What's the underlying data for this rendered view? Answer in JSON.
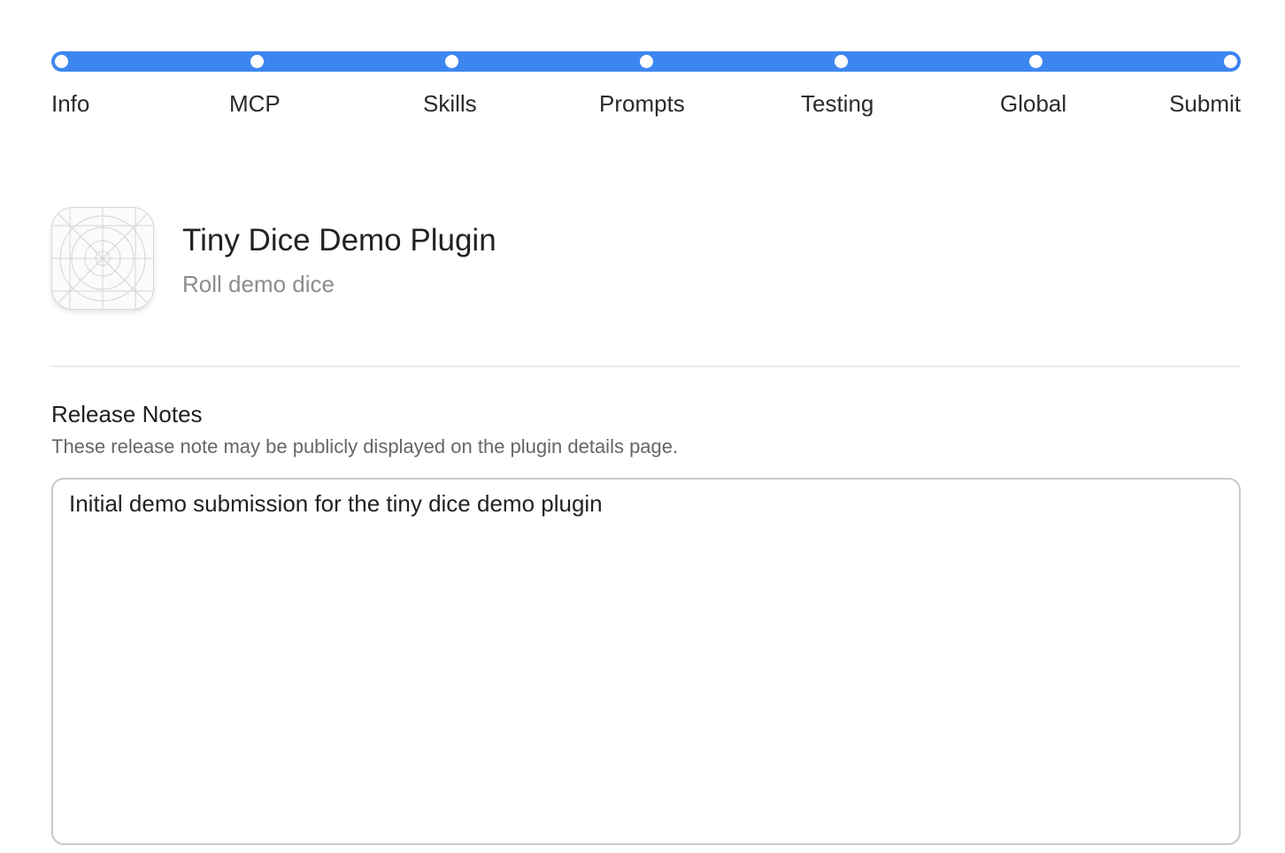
{
  "stepper": {
    "accent_color": "#3d86f0",
    "steps": [
      {
        "label": "Info"
      },
      {
        "label": "MCP"
      },
      {
        "label": "Skills"
      },
      {
        "label": "Prompts"
      },
      {
        "label": "Testing"
      },
      {
        "label": "Global"
      },
      {
        "label": "Submit"
      }
    ],
    "progress": 1.0
  },
  "plugin": {
    "title": "Tiny Dice Demo Plugin",
    "subtitle": "Roll demo dice",
    "icon": "app-icon-placeholder"
  },
  "release_notes": {
    "title": "Release Notes",
    "help_text": "These release note may be publicly displayed on the plugin details page.",
    "value": "Initial demo submission for the tiny dice demo plugin"
  }
}
